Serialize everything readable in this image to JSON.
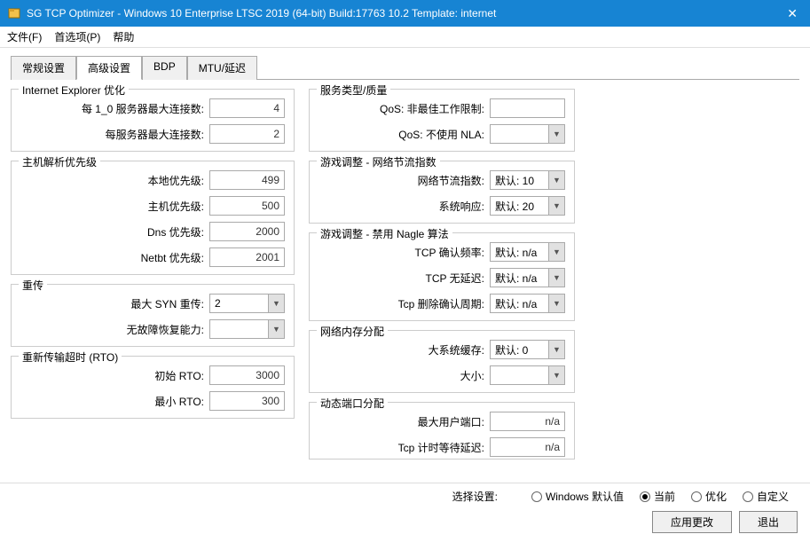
{
  "titlebar": {
    "title": "SG TCP Optimizer - Windows 10 Enterprise LTSC 2019 (64-bit) Build:17763 10.2  Template: internet"
  },
  "menubar": {
    "file": "文件(F)",
    "prefs": "首选项(P)",
    "help": "帮助"
  },
  "tabs": {
    "general": "常规设置",
    "advanced": "高级设置",
    "bdp": "BDP",
    "mtu": "MTU/延迟"
  },
  "groups": {
    "ie": {
      "title": "Internet Explorer 优化",
      "per10_label": "每 1_0 服务器最大连接数:",
      "per10_value": "4",
      "per_label": "每服务器最大连接数:",
      "per_value": "2"
    },
    "hostres": {
      "title": "主机解析优先级",
      "local_label": "本地优先级:",
      "local_value": "499",
      "host_label": "主机优先级:",
      "host_value": "500",
      "dns_label": "Dns 优先级:",
      "dns_value": "2000",
      "netbt_label": "Netbt 优先级:",
      "netbt_value": "2001"
    },
    "retrans": {
      "title": "重传",
      "syn_label": "最大 SYN 重传:",
      "syn_value": "2",
      "recover_label": "无故障恢复能力:",
      "recover_value": ""
    },
    "rto": {
      "title": "重新传输超时 (RTO)",
      "init_label": "初始 RTO:",
      "init_value": "3000",
      "min_label": "最小 RTO:",
      "min_value": "300"
    },
    "qos": {
      "title": "服务类型/质量",
      "nonbest_label": "QoS: 非最佳工作限制:",
      "nonbest_value": "",
      "nla_label": "QoS: 不使用 NLA:",
      "nla_value": ""
    },
    "throttle": {
      "title": "游戏调整 - 网络节流指数",
      "index_label": "网络节流指数:",
      "index_value": "默认: 10",
      "response_label": "系统响应:",
      "response_value": "默认: 20"
    },
    "nagle": {
      "title": "游戏调整 - 禁用 Nagle 算法",
      "ackfreq_label": "TCP 确认频率:",
      "ackfreq_value": "默认: n/a",
      "nodelay_label": "TCP 无延迟:",
      "nodelay_value": "默认: n/a",
      "delack_label": "Tcp 删除确认周期:",
      "delack_value": "默认: n/a"
    },
    "memory": {
      "title": "网络内存分配",
      "largecache_label": "大系统缓存:",
      "largecache_value": "默认: 0",
      "size_label": "大小:",
      "size_value": ""
    },
    "dynport": {
      "title": "动态端口分配",
      "maxport_label": "最大用户端口:",
      "maxport_value": "n/a",
      "timewait_label": "Tcp 计时等待延迟:",
      "timewait_value": "n/a"
    }
  },
  "bottom": {
    "select_label": "选择设置:",
    "opt_default": "Windows 默认值",
    "opt_current": "当前",
    "opt_optimize": "优化",
    "opt_custom": "自定义",
    "apply": "应用更改",
    "exit": "退出"
  }
}
